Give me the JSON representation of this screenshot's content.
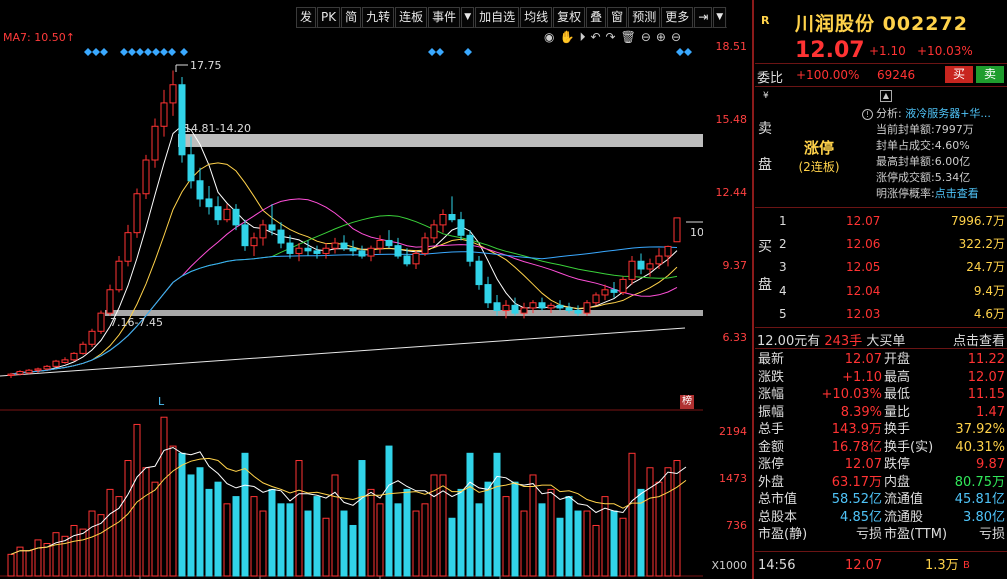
{
  "toolbar": {
    "items": [
      "发",
      "PK",
      "简",
      "九转",
      "连板",
      "事件",
      "▼",
      "加自选",
      "均线",
      "复权",
      "叠",
      "窗",
      "预测",
      "更多"
    ],
    "extra_icons": [
      "logout-icon",
      "menu-down-icon"
    ]
  },
  "chart": {
    "ma_label": "MA7: 10.50↑",
    "high_label": "17.75",
    "range_label_top": "14.81-14.20",
    "range_label_bottom": "7.16-7.45",
    "axis_prices": [
      "18.51",
      "15.48",
      "12.44",
      "9.37",
      "6.33"
    ],
    "axis_volumes": [
      "2194",
      "1473",
      "736"
    ],
    "vol_unit": "X1000",
    "price_marker": "10",
    "l_marker": "L",
    "bang_label": "榜",
    "candles": [
      [
        6.0,
        6.1,
        5.9,
        6.05
      ],
      [
        6.05,
        6.2,
        6.0,
        6.15
      ],
      [
        6.1,
        6.25,
        6.05,
        6.2
      ],
      [
        6.2,
        6.3,
        6.1,
        6.25
      ],
      [
        6.25,
        6.4,
        6.2,
        6.35
      ],
      [
        6.35,
        6.6,
        6.3,
        6.55
      ],
      [
        6.5,
        6.7,
        6.45,
        6.6
      ],
      [
        6.6,
        6.9,
        6.55,
        6.85
      ],
      [
        6.85,
        7.3,
        6.8,
        7.2
      ],
      [
        7.2,
        7.8,
        7.1,
        7.7
      ],
      [
        7.7,
        8.5,
        7.6,
        8.4
      ],
      [
        8.4,
        9.5,
        8.3,
        9.3
      ],
      [
        9.3,
        10.6,
        9.2,
        10.4
      ],
      [
        10.4,
        11.8,
        10.2,
        11.5
      ],
      [
        11.5,
        13.2,
        11.3,
        13.0
      ],
      [
        13.0,
        14.5,
        12.8,
        14.3
      ],
      [
        14.3,
        15.9,
        14.0,
        15.6
      ],
      [
        15.6,
        17.0,
        15.2,
        16.5
      ],
      [
        16.5,
        17.75,
        16.0,
        17.2
      ],
      [
        17.2,
        17.5,
        14.2,
        14.5
      ],
      [
        14.5,
        15.2,
        13.2,
        13.5
      ],
      [
        13.5,
        14.0,
        12.5,
        12.8
      ],
      [
        12.8,
        13.3,
        12.2,
        12.5
      ],
      [
        12.5,
        12.9,
        11.8,
        12.0
      ],
      [
        12.0,
        12.6,
        11.9,
        12.4
      ],
      [
        12.4,
        12.6,
        11.6,
        11.8
      ],
      [
        11.8,
        12.0,
        10.8,
        11.0
      ],
      [
        11.0,
        11.5,
        10.6,
        11.3
      ],
      [
        11.3,
        12.0,
        11.0,
        11.8
      ],
      [
        11.8,
        12.6,
        11.4,
        11.6
      ],
      [
        11.6,
        11.9,
        10.9,
        11.1
      ],
      [
        11.1,
        11.4,
        10.5,
        10.7
      ],
      [
        10.7,
        11.1,
        10.4,
        10.9
      ],
      [
        10.9,
        11.2,
        10.6,
        10.8
      ],
      [
        10.8,
        11.0,
        10.5,
        10.7
      ],
      [
        10.7,
        11.1,
        10.5,
        10.9
      ],
      [
        10.9,
        11.3,
        10.7,
        11.1
      ],
      [
        11.1,
        11.4,
        10.8,
        10.9
      ],
      [
        10.9,
        11.2,
        10.6,
        10.8
      ],
      [
        10.8,
        11.0,
        10.5,
        10.6
      ],
      [
        10.6,
        11.0,
        10.4,
        10.9
      ],
      [
        10.9,
        11.4,
        10.7,
        11.2
      ],
      [
        11.2,
        11.6,
        10.9,
        11.0
      ],
      [
        11.0,
        11.3,
        10.5,
        10.6
      ],
      [
        10.6,
        10.9,
        10.2,
        10.3
      ],
      [
        10.3,
        10.8,
        10.1,
        10.7
      ],
      [
        10.7,
        11.5,
        10.6,
        11.3
      ],
      [
        11.3,
        12.0,
        11.1,
        11.8
      ],
      [
        11.8,
        12.4,
        11.5,
        12.2
      ],
      [
        12.2,
        12.9,
        11.9,
        12.0
      ],
      [
        12.0,
        12.3,
        11.2,
        11.4
      ],
      [
        11.4,
        11.6,
        10.2,
        10.4
      ],
      [
        10.4,
        10.6,
        9.3,
        9.5
      ],
      [
        9.5,
        9.8,
        8.6,
        8.8
      ],
      [
        8.8,
        9.1,
        8.3,
        8.5
      ],
      [
        8.5,
        8.9,
        8.2,
        8.7
      ],
      [
        8.7,
        9.0,
        8.3,
        8.4
      ],
      [
        8.4,
        8.8,
        8.2,
        8.6
      ],
      [
        8.6,
        8.9,
        8.4,
        8.8
      ],
      [
        8.8,
        9.0,
        8.5,
        8.6
      ],
      [
        8.6,
        8.8,
        8.4,
        8.7
      ],
      [
        8.7,
        8.9,
        8.5,
        8.6
      ],
      [
        8.6,
        8.8,
        8.4,
        8.5
      ],
      [
        8.5,
        8.7,
        8.3,
        8.4
      ],
      [
        8.4,
        8.9,
        8.3,
        8.8
      ],
      [
        8.8,
        9.2,
        8.7,
        9.1
      ],
      [
        9.1,
        9.5,
        8.9,
        9.3
      ],
      [
        9.3,
        9.6,
        9.0,
        9.2
      ],
      [
        9.2,
        9.8,
        9.1,
        9.7
      ],
      [
        9.7,
        10.6,
        9.5,
        10.4
      ],
      [
        10.4,
        10.7,
        9.9,
        10.1
      ],
      [
        10.1,
        10.5,
        9.8,
        10.3
      ],
      [
        10.3,
        10.9,
        10.1,
        10.6
      ],
      [
        10.6,
        11.0,
        10.2,
        10.97
      ],
      [
        11.15,
        12.07,
        11.15,
        12.07
      ]
    ],
    "volumes": [
      300,
      400,
      350,
      500,
      450,
      600,
      550,
      700,
      650,
      900,
      850,
      1200,
      1100,
      1600,
      2100,
      1500,
      1300,
      2200,
      1800,
      1700,
      1400,
      1500,
      1200,
      1300,
      1000,
      1100,
      1700,
      1100,
      900,
      1200,
      1000,
      1000,
      1600,
      900,
      1100,
      800,
      1400,
      900,
      700,
      1600,
      1200,
      1000,
      1800,
      1000,
      1200,
      900,
      1000,
      1400,
      1400,
      800,
      1200,
      1700,
      1000,
      1300,
      1700,
      1100,
      1300,
      900,
      1400,
      1000,
      1200,
      800,
      1100,
      900,
      900,
      700,
      1100,
      900,
      800,
      1700,
      1200,
      1500,
      1300,
      1500,
      1600,
      1650
    ]
  },
  "side": {
    "code_badge": "R",
    "title": "川润股份 002272",
    "price": "12.07",
    "change": "+1.10",
    "change_pct": "+10.03%",
    "weibi_label": "委比",
    "weibi_value": "+100.00%",
    "weibi_diff": "69246",
    "buy_btn": "买",
    "sell_btn": "卖",
    "sell_side_chars": [
      "卖",
      "盘"
    ],
    "yen": "¥",
    "limit_title": "涨停",
    "limit_sub": "(2连板)",
    "analysis": {
      "label": "分析:",
      "value": "液冷服务器+华...",
      "rows": [
        [
          "当前封单额:",
          "7997万"
        ],
        [
          "封单占成交:",
          "4.60%"
        ],
        [
          "最高封单额:",
          "6.00亿"
        ],
        [
          "涨停成交额:",
          "5.34亿"
        ],
        [
          "明涨停概率:",
          "点击查看"
        ]
      ]
    },
    "buy_side_chars": [
      "买",
      "盘"
    ],
    "bids": [
      [
        "1",
        "12.07",
        "7996.7万"
      ],
      [
        "2",
        "12.06",
        "322.2万"
      ],
      [
        "3",
        "12.05",
        "24.7万"
      ],
      [
        "4",
        "12.04",
        "9.4万"
      ],
      [
        "5",
        "12.03",
        "4.6万"
      ]
    ],
    "bigbuy": {
      "price": "12.00",
      "unit": "元有",
      "lots": "243手",
      "label": "大买单",
      "link": "点击查看"
    },
    "quote": [
      [
        "最新",
        "12.07",
        "开盘",
        "11.22"
      ],
      [
        "涨跌",
        "+1.10",
        "最高",
        "12.07"
      ],
      [
        "涨幅",
        "+10.03%",
        "最低",
        "11.15"
      ],
      [
        "振幅",
        "8.39%",
        "量比",
        "1.47"
      ],
      [
        "总手",
        "143.9万",
        "换手",
        "37.92%"
      ],
      [
        "金额",
        "16.78亿",
        "换手(实)",
        "40.31%"
      ],
      [
        "涨停",
        "12.07",
        "跌停",
        "9.87"
      ],
      [
        "外盘",
        "63.17万",
        "内盘",
        "80.75万"
      ],
      [
        "总市值",
        "58.52亿",
        "流通值",
        "45.81亿"
      ],
      [
        "总股本",
        "4.85亿",
        "流通股",
        "3.80亿"
      ],
      [
        "市盈(静)",
        "亏损",
        "市盈(TTM)",
        "亏损"
      ]
    ],
    "tick": {
      "time": "14:56",
      "price": "12.07",
      "qty": "1.3万",
      "dir": "B"
    }
  },
  "colors": {
    "up": "#ff3333",
    "down": "#31d3e8",
    "yellow": "#ffd24a",
    "cyan": "#4fc3f7"
  }
}
